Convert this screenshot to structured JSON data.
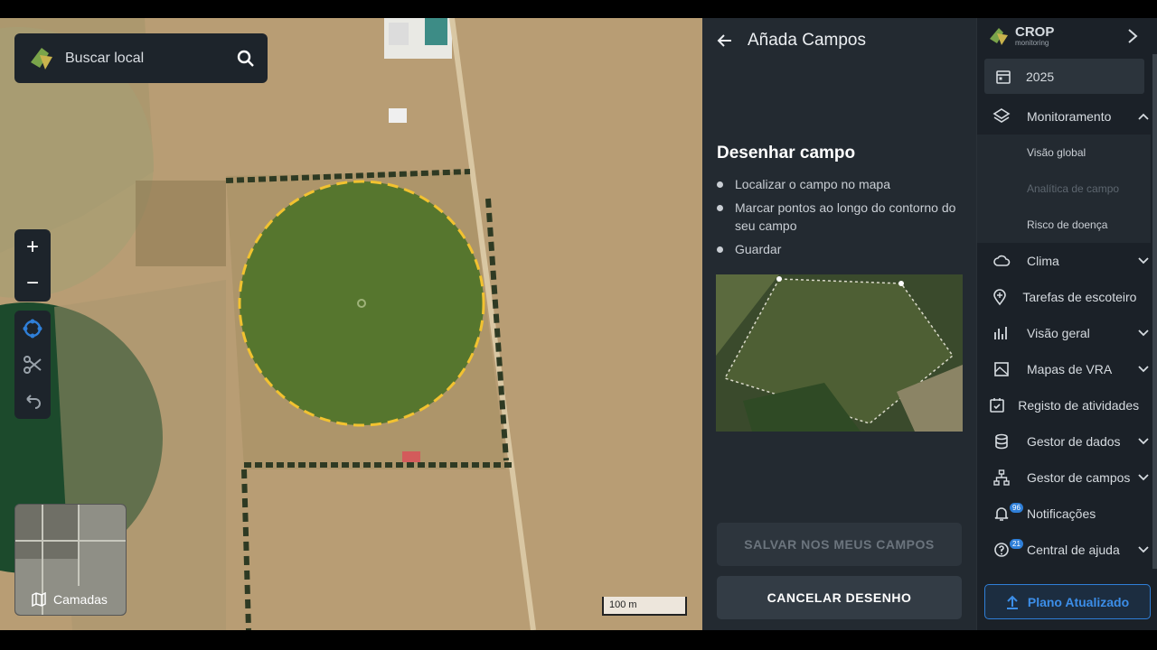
{
  "map": {
    "search_placeholder": "Buscar local",
    "layers_label": "Camadas",
    "scale_label": "100 m",
    "zoom_in": "+",
    "zoom_out": "−"
  },
  "panel": {
    "header_title": "Añada Campos",
    "section_title": "Desenhar campo",
    "steps": [
      "Localizar o campo no mapa",
      "Marcar pontos ao longo do contorno do seu campo",
      "Guardar"
    ],
    "save_button": "SALVAR NOS MEUS CAMPOS",
    "cancel_button": "CANCELAR DESENHO"
  },
  "sidebar": {
    "logo_title": "CROP",
    "logo_sub": "monitoring",
    "year": "2025",
    "items": [
      {
        "label": "Monitoramento",
        "icon": "layers-icon",
        "expanded": true
      },
      {
        "label": "Clima",
        "icon": "cloud-icon"
      },
      {
        "label": "Tarefas de escoteiro",
        "icon": "pin-icon"
      },
      {
        "label": "Visão geral",
        "icon": "bar-chart-icon"
      },
      {
        "label": "Mapas de VRA",
        "icon": "map-image-icon"
      },
      {
        "label": "Registo de atividades",
        "icon": "calendar-check-icon"
      },
      {
        "label": "Gestor de dados",
        "icon": "database-icon"
      },
      {
        "label": "Gestor de campos",
        "icon": "hierarchy-icon"
      },
      {
        "label": "Notificações",
        "icon": "bell-icon",
        "badge": "96"
      },
      {
        "label": "Central de ajuda",
        "icon": "help-icon",
        "badge": "21"
      }
    ],
    "monitoring_sub": [
      "Visão global",
      "Analítica de campo",
      "Risco de doença"
    ],
    "upgrade_button": "Plano Atualizado"
  },
  "colors": {
    "accent": "#2f7fd8",
    "panel": "#232a31",
    "sidebar": "#1b2128",
    "drawing_outline": "#f2c230"
  }
}
